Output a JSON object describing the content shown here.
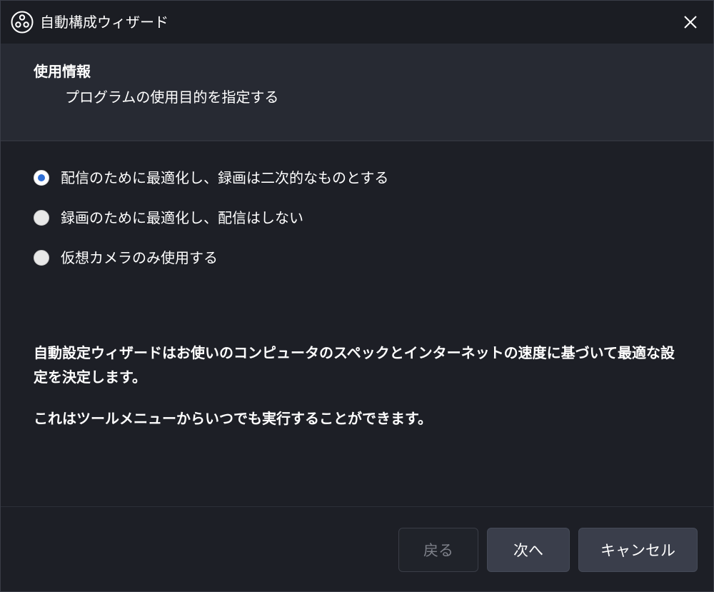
{
  "window": {
    "title": "自動構成ウィザード"
  },
  "header": {
    "title": "使用情報",
    "subtitle": "プログラムの使用目的を指定する"
  },
  "options": [
    {
      "label": "配信のために最適化し、録画は二次的なものとする",
      "checked": true
    },
    {
      "label": "録画のために最適化し、配信はしない",
      "checked": false
    },
    {
      "label": "仮想カメラのみ使用する",
      "checked": false
    }
  ],
  "description": {
    "paragraph1": "自動設定ウィザードはお使いのコンピュータのスペックとインターネットの速度に基づいて最適な設定を決定します。",
    "paragraph2": "これはツールメニューからいつでも実行することができます。"
  },
  "buttons": {
    "back": "戻る",
    "next": "次へ",
    "cancel": "キャンセル"
  },
  "colors": {
    "background": "#1d1f26",
    "header_panel": "#272a33",
    "accent_radio": "#2f6fd6",
    "button": "#3a3e4b",
    "disabled_text": "#7e818a"
  },
  "icons": {
    "app": "obs-logo-icon",
    "close": "close-icon"
  }
}
